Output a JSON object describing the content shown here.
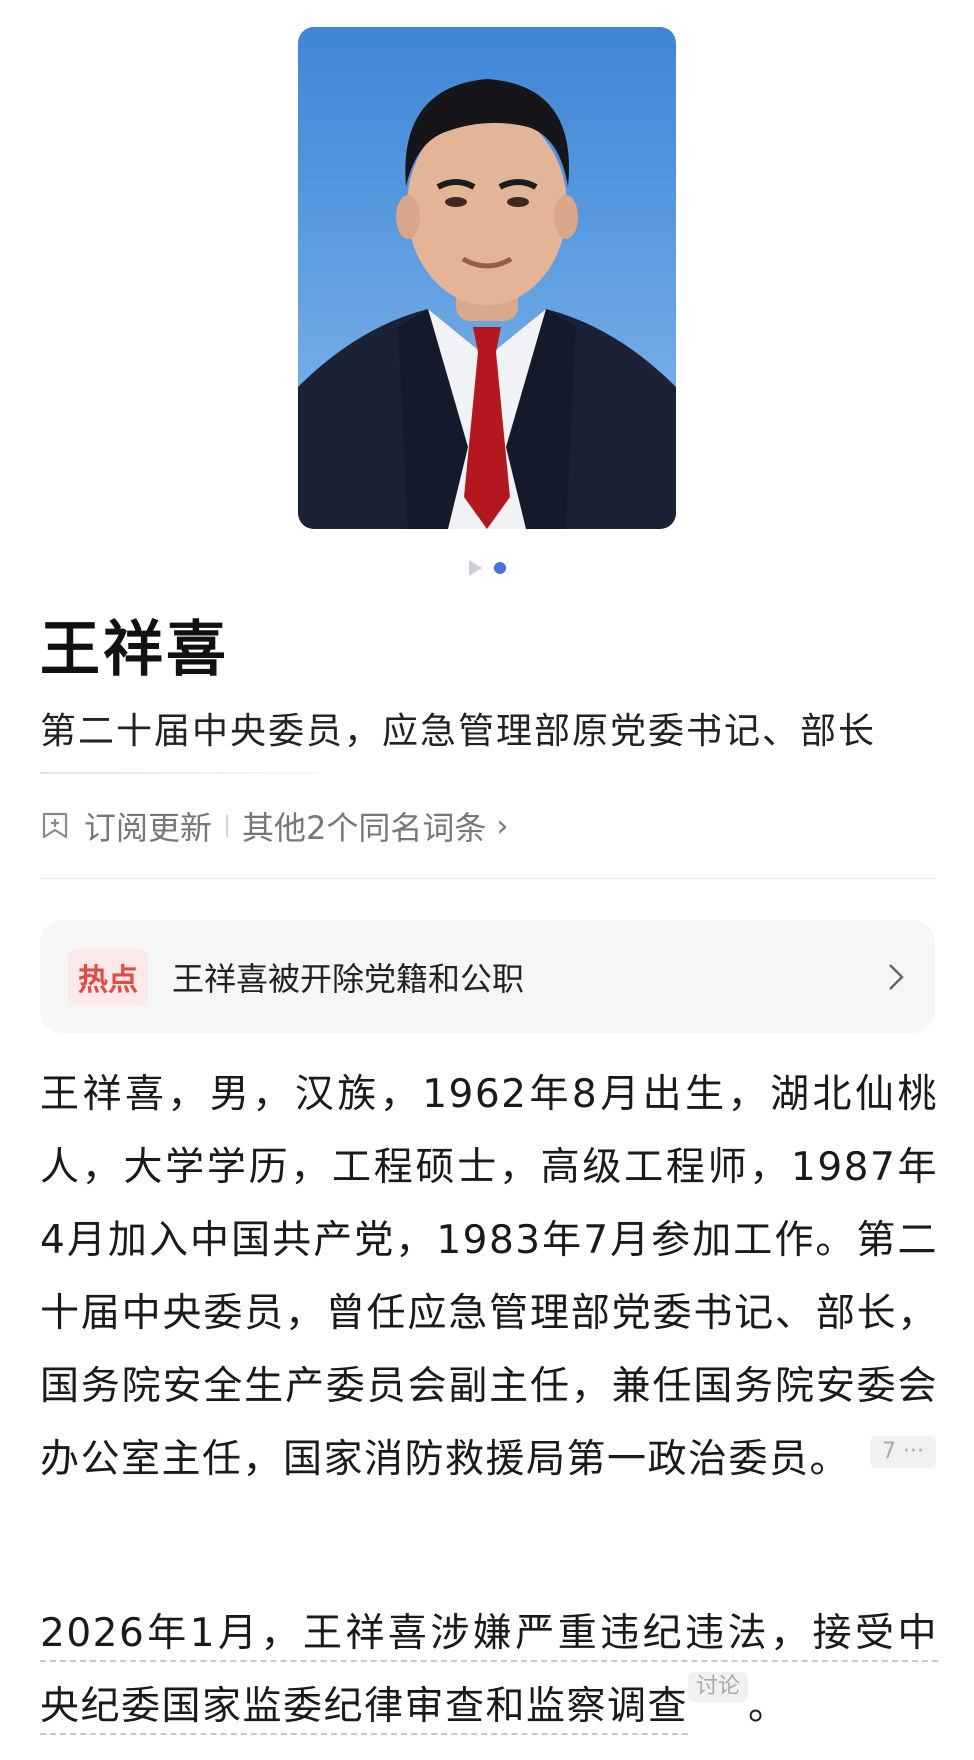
{
  "person": {
    "name": "王祥喜",
    "subtitle": "第二十届中央委员，应急管理部原党委书记、部长"
  },
  "meta": {
    "subscribe_label": "订阅更新",
    "same_name_label": "其他2个同名词条"
  },
  "hot": {
    "badge": "热点",
    "headline": "王祥喜被开除党籍和公职"
  },
  "intro": {
    "text": "王祥喜，男，汉族，1962年8月出生，湖北仙桃人，大学学历，工程硕士，高级工程师，1987年4月加入中国共产党，1983年7月参加工作。第二十届中央委员，曾任应急管理部党委书记、部长，国务院安全生产委员会副主任，兼任国务院安委会办公室主任，国家消防救援局第一政治委员。",
    "ref_label": "7 ···"
  },
  "event": {
    "text": "2026年1月，王祥喜涉嫌严重违纪违法，接受中央纪委国家监委纪律审查和监察调查",
    "tail": "。",
    "discuss_label": "讨论"
  },
  "colors": {
    "accent_blue": "#4a6fd8",
    "hot_red": "#e24a42",
    "photo_bg": "#4a8fdc"
  },
  "icons": {
    "subscribe": "bell-plus-icon",
    "chevron": "chevron-right-icon",
    "play": "play-icon"
  }
}
